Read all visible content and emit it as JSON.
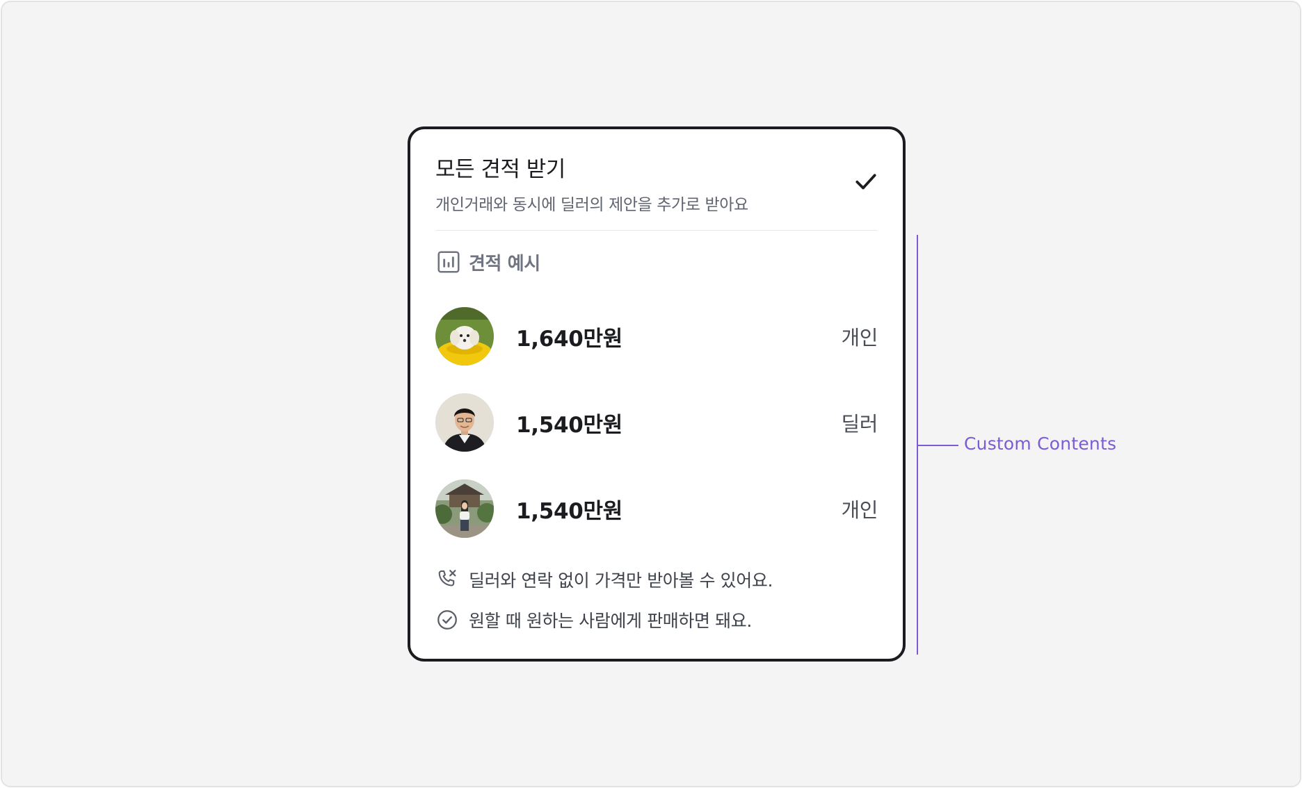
{
  "card": {
    "title": "모든 견적 받기",
    "subtitle": "개인거래와 동시에 딜러의 제안을 추가로 받아요",
    "checked": true,
    "check_icon": "checkmark-icon"
  },
  "section": {
    "icon": "bar-chart-icon",
    "title": "견적 예시"
  },
  "offers": [
    {
      "avatar": "dog-avatar",
      "price": "1,640만원",
      "kind": "개인"
    },
    {
      "avatar": "man-avatar",
      "price": "1,540만원",
      "kind": "딜러"
    },
    {
      "avatar": "woman-avatar",
      "price": "1,540만원",
      "kind": "개인"
    }
  ],
  "notes": [
    {
      "icon": "phone-blocked-icon",
      "text": "딜러와 연락 없이 가격만 받아볼 수 있어요."
    },
    {
      "icon": "check-circle-icon",
      "text": "원할 때 원하는 사람에게 판매하면 돼요."
    }
  ],
  "annotation": {
    "label": "Custom Contents",
    "color": "#7b5cd6"
  }
}
